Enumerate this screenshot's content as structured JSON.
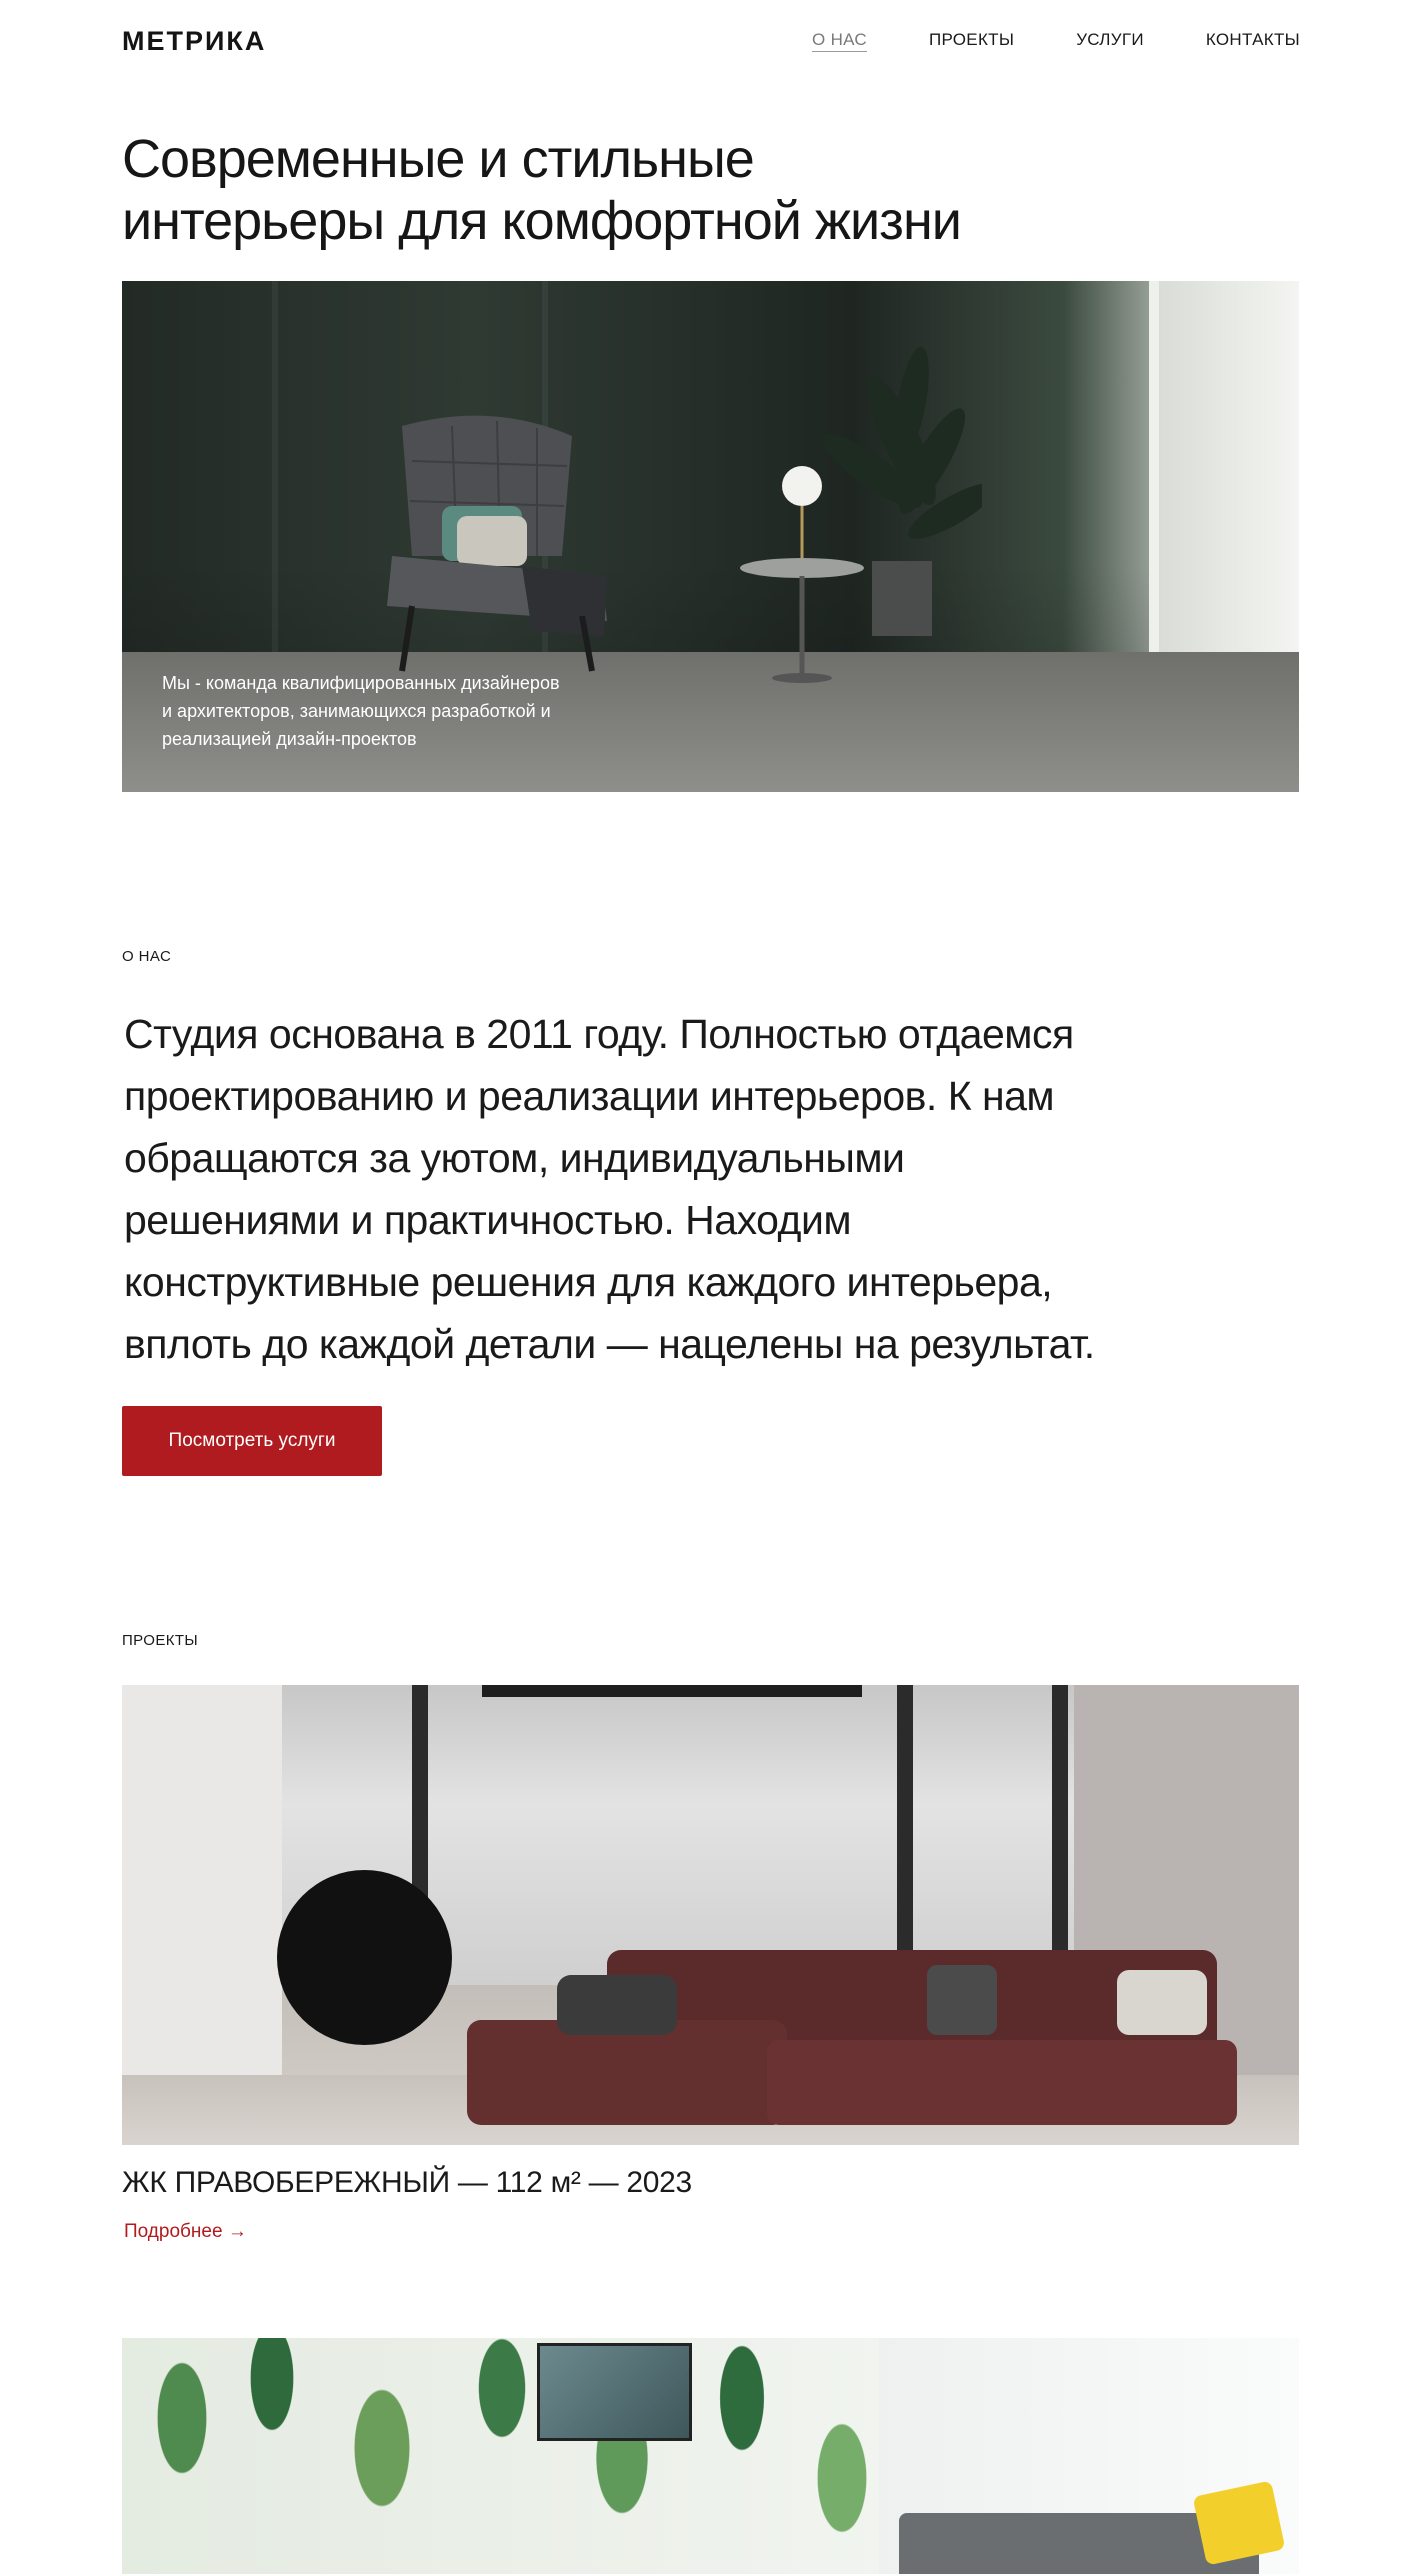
{
  "header": {
    "logo": "МЕТРИКА",
    "nav": [
      {
        "label": "О НАС",
        "active": true
      },
      {
        "label": "ПРОЕКТЫ",
        "active": false
      },
      {
        "label": "УСЛУГИ",
        "active": false
      },
      {
        "label": "КОНТАКТЫ",
        "active": false
      }
    ]
  },
  "hero": {
    "title_line1": "Современные и стильные",
    "title_line2": "интерьеры для комфортной жизни",
    "caption_line1": "Мы - команда квалифицированных дизайнеров",
    "caption_line2": "и архитекторов, занимающихся разработкой и",
    "caption_line3": "реализацией дизайн-проектов"
  },
  "about": {
    "label": "О НАС",
    "lines": [
      "Студия основана в 2011 году. Полностью отдаемся",
      "проектированию и реализации интерьеров. К нам",
      "обращаются за уютом, индивидуальными",
      "решениями и практичностью. Находим",
      "конструктивные решения для каждого интерьера,",
      "вплоть до каждой детали — нацелены на результат."
    ],
    "button": "Посмотреть услуги"
  },
  "projects": {
    "label": "ПРОЕКТЫ",
    "items": [
      {
        "title": "ЖК ПРАВОБЕРЕЖНЫЙ — 112 м² — 2023",
        "link": "Подробнее →"
      }
    ]
  },
  "colors": {
    "accent": "#b01b1f",
    "text": "#141414",
    "background": "#ffffff"
  }
}
